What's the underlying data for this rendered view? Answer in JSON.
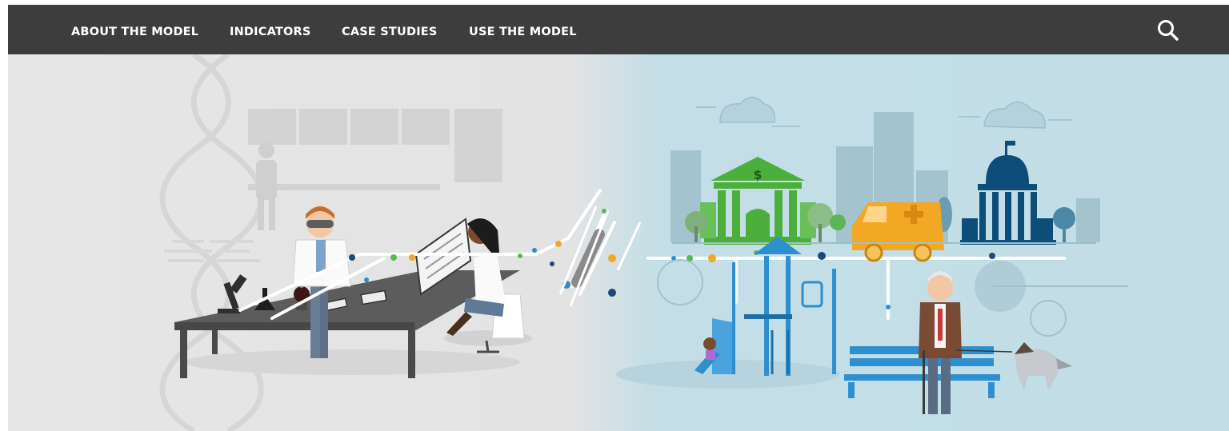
{
  "nav": {
    "items": [
      {
        "label": "ABOUT THE MODEL"
      },
      {
        "label": "INDICATORS"
      },
      {
        "label": "CASE STUDIES"
      },
      {
        "label": "USE THE MODEL"
      }
    ],
    "search_icon": "search-icon",
    "background": "#3d3d3d"
  },
  "hero": {
    "bank_symbol": "$",
    "colors": {
      "left_bg": "#e5e5e5",
      "right_bg": "#c2dde6",
      "bank": "#4caf3c",
      "ambulance": "#f2a725",
      "capitol": "#0d4d7a",
      "playground": "#2e8fcf"
    }
  }
}
